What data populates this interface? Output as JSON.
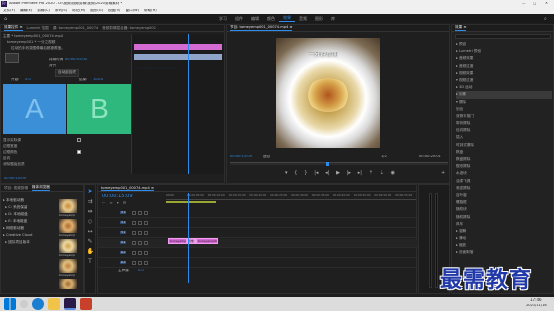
{
  "titlebar": {
    "title": "Adobe Premiere Pro 2020 - D:\\视频\\视频剪辑\\视频\\2020剪辑素材 *"
  },
  "menubar": {
    "items": [
      "文件(F)",
      "编辑(E)",
      "剪辑(C)",
      "序列(S)",
      "标记(M)",
      "图形(G)",
      "视图(V)",
      "窗口(W)",
      "帮助(H)"
    ]
  },
  "workspaces": {
    "items": [
      "学习",
      "组件",
      "编辑",
      "颜色",
      "效果",
      "音频",
      "图形",
      "库"
    ],
    "active": 4
  },
  "effect_controls": {
    "tabs": [
      "效果控件 ≡",
      "Lumetri 范围",
      "源: tomeyemp001_00074",
      "音频剪辑混合器: tomeyemp001"
    ],
    "source_label": "主要 * tomeyemp001_00074.mp4",
    "seq_label": "tomeyemp001 * 一分之视频",
    "fx_name": "划像",
    "fx_desc": "拉动拍手划变图像最后都被覆盖。",
    "duration_label": "持续时间",
    "duration_value": "00:00:01:00",
    "align_label": "对齐",
    "align_value": "自动起自终",
    "start_label": "开始:",
    "start_value": "0.0",
    "end_label": "结束:",
    "end_value": "100.0",
    "a_letter": "A",
    "b_letter": "B",
    "show_actual": "显示实际源",
    "border_width": "边框宽度",
    "border_color": "边框颜色",
    "reverse": "反向",
    "antialias": "消除锯齿品质",
    "timecode": "00:00:15:09",
    "clip_a": "tomeyemp001_00074.mp4",
    "clip_b": "tomeyemp001_00074.mp4"
  },
  "program": {
    "tab": "节目: tomeyemp001_00074.mp4 ≡",
    "overlay_text": "一分钟新闻",
    "timecode": "00:00:15:09",
    "fit": "适合",
    "quality": "1/2",
    "duration": "00:00:20:01",
    "scale_left": "00:00:00:00",
    "scale_right": "00:00:25:00"
  },
  "project": {
    "tabs": [
      "项目: 视频剪辑",
      "媒体浏览器"
    ],
    "items": [
      "tomeyemp",
      "tomeyemp",
      "tomeyemp",
      "tomeyemp",
      "tomeyemp"
    ],
    "tree": [
      "▸ 本地驱动器",
      "  ▸ C: 系统保留",
      "  ▸ D: 本地磁盘",
      "  ▸ E: 本地磁盘",
      "▸ 网络驱动器",
      "▸ Creative Cloud",
      "  ▸ 团队项目版本"
    ]
  },
  "timeline": {
    "tab": "tomeyemp001_00074.mp4 ≡",
    "timecode": "00:00:15:09",
    "ruler": [
      "00:00",
      "00:00:05:00",
      "00:00:10:00",
      "00:00:15:00",
      "00:00:20:00",
      "00:00:25:00",
      "00:00:30:00",
      "00:00:35:00",
      "00:00:40:00",
      "00:00:45:00",
      "00:00:50:00",
      "00:00:55:00"
    ],
    "tracks": [
      "V3",
      "V2",
      "V1",
      "A1",
      "A2",
      "A3"
    ],
    "master": "主声道",
    "master_val": "0.0",
    "clip1": "tomeyemp",
    "clip2": "tomeyemp001",
    "clip_trans": "划像"
  },
  "effects": {
    "title": "效果 ≡",
    "items": [
      "▸ 预设",
      "▸ Lumetri 预设",
      "▸ 音频效果",
      "▸ 音频过渡",
      "▸ 视频效果",
      "▾ 视频过渡",
      "  ▸ 3D 运动",
      "  ▸ 划像",
      "  ▾ 擦除",
      "     划出",
      "     双侧平推门",
      "     带状擦除",
      "     径向擦除",
      "     插入",
      "     时钟式擦除",
      "     棋盘",
      "     棋盘擦除",
      "     楔形擦除",
      "     水波块",
      "     油漆飞溅",
      "     渐变擦除",
      "     百叶窗",
      "     螺旋框",
      "     随机块",
      "     随机擦除",
      "     风车",
      "  ▸ 溶解",
      "  ▸ 滑动",
      "  ▸ 缩放",
      "  ▸ 页面剥落"
    ],
    "selected_index": 7
  },
  "watermark": {
    "text": "最需教育"
  },
  "taskbar": {
    "time": "17:46",
    "date": "2021/11/16"
  },
  "colors": {
    "accent": "#2d8ceb",
    "clip": "#d36bd3",
    "a_panel": "#3b8fd6",
    "b_panel": "#2fb87e"
  }
}
